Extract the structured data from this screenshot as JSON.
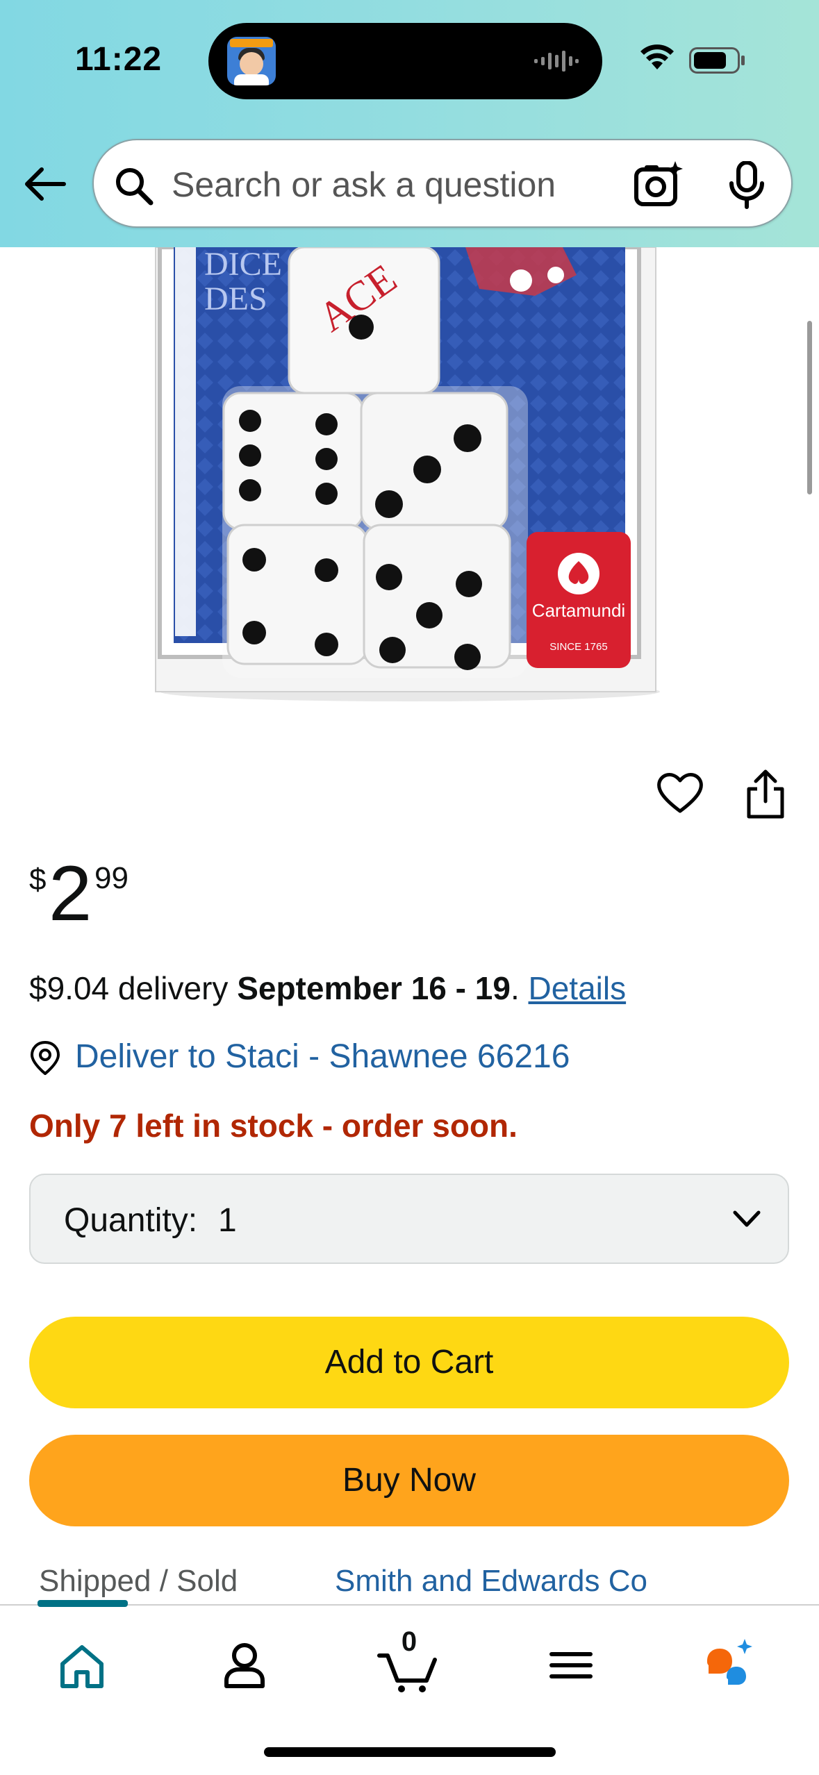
{
  "status_bar": {
    "time": "11:22"
  },
  "search": {
    "placeholder": "Search or ask a question"
  },
  "product": {
    "price_symbol": "$",
    "price_whole": "2",
    "price_fraction": "99",
    "delivery_prefix": "$9.04 delivery ",
    "delivery_date": "September 16 - 19",
    "delivery_period": ". ",
    "details_link": "Details",
    "deliver_to": "Deliver to Staci - Shawnee 66216",
    "stock_message": "Only 7 left in stock - order soon.",
    "quantity_label": "Quantity:",
    "quantity_value": "1",
    "add_to_cart_label": "Add to Cart",
    "buy_now_label": "Buy Now",
    "shipped_sold_label": "Shipped / Sold",
    "seller_name": "Smith and Edwards Co",
    "image_text": {
      "brand": "Cartamundi",
      "since": "SINCE 1765",
      "pack_line1": "DICE",
      "pack_line2": "DES",
      "ace": "ACE"
    }
  },
  "tabbar": {
    "cart_count": "0",
    "active_tab": "home"
  },
  "colors": {
    "header_gradient_start": "#82d8e3",
    "header_gradient_end": "#a5e4d8",
    "link": "#2162a1",
    "stock_red": "#b12704",
    "add_to_cart": "#fed813",
    "buy_now": "#ffa41c",
    "active_tab": "#007185"
  },
  "icons": [
    "back-arrow-icon",
    "search-icon",
    "camera-lens-icon",
    "microphone-icon",
    "heart-icon",
    "share-icon",
    "location-pin-icon",
    "chevron-down-icon",
    "home-icon",
    "account-icon",
    "cart-icon",
    "menu-icon",
    "rufus-chat-icon"
  ]
}
